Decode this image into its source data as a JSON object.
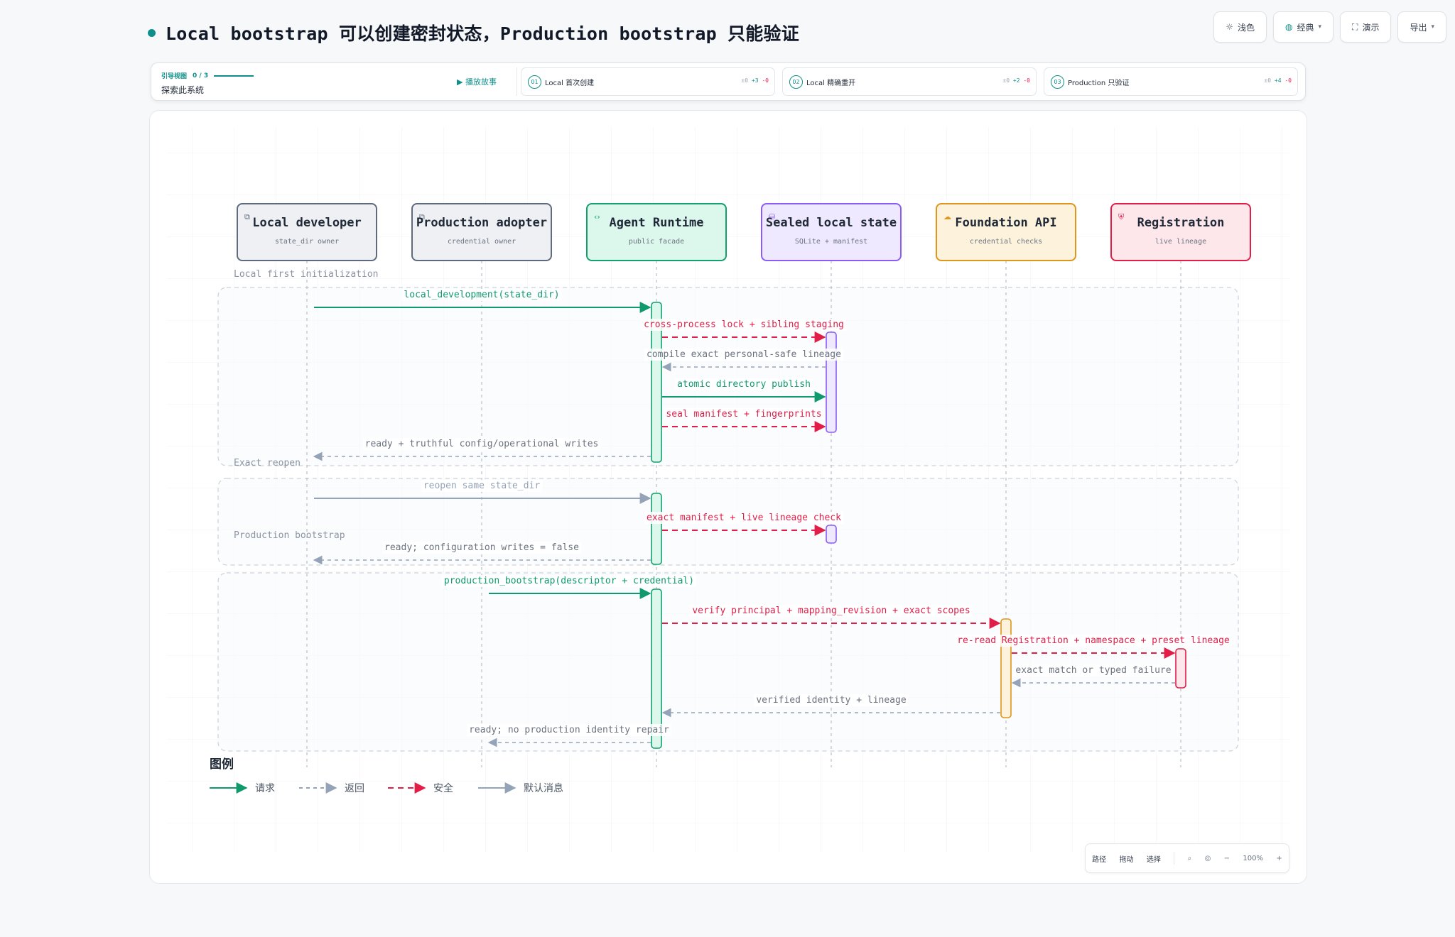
{
  "title": "Local bootstrap 可以创建密封状态，Production bootstrap 只能验证",
  "toolbar": [
    {
      "icon": "sun-icon",
      "label": "浅色",
      "dropdown": false
    },
    {
      "icon": "palette-icon",
      "label": "经典",
      "dropdown": true
    },
    {
      "icon": "fullscreen-icon",
      "label": "演示",
      "dropdown": false
    },
    {
      "icon": "",
      "label": "导出",
      "dropdown": true
    }
  ],
  "guide": {
    "kicker": "引导视图",
    "progress": "0 / 3",
    "subtitle": "探索此系统",
    "play_label": "播放故事",
    "steps": [
      {
        "num": "01",
        "label": "Local 首次创建",
        "zero": "±0",
        "plus": "+3",
        "minus": "-0"
      },
      {
        "num": "02",
        "label": "Local 精确重开",
        "zero": "±0",
        "plus": "+2",
        "minus": "-0"
      },
      {
        "num": "03",
        "label": "Production 只验证",
        "zero": "±0",
        "plus": "+4",
        "minus": "-0"
      }
    ]
  },
  "colors": {
    "request": "#0e9a6c",
    "return": "#94a3b8",
    "security": "#e11d48",
    "default": "#94a3b8"
  },
  "participants": [
    {
      "id": "local",
      "name": "Local developer",
      "sub": "state_dir owner",
      "icon": "external-link-icon",
      "fill": "#eef0f4",
      "stroke": "#5f6b7d",
      "bar": "#5f6b7d"
    },
    {
      "id": "prod",
      "name": "Production adopter",
      "sub": "credential owner",
      "icon": "external-link-icon",
      "fill": "#eef0f4",
      "stroke": "#5f6b7d",
      "bar": "#5f6b7d"
    },
    {
      "id": "runtime",
      "name": "Agent Runtime",
      "sub": "public facade",
      "icon": "code-icon",
      "fill": "#dcf7ec",
      "stroke": "#15a06f",
      "bar": "#15a06f"
    },
    {
      "id": "sealed",
      "name": "Sealed local state",
      "sub": "SQLite + manifest",
      "icon": "database-icon",
      "fill": "#efe9ff",
      "stroke": "#8b5cf6",
      "bar": "#8b5cf6"
    },
    {
      "id": "foundation",
      "name": "Foundation API",
      "sub": "credential checks",
      "icon": "cloud-icon",
      "fill": "#fdf3dc",
      "stroke": "#e0951c",
      "bar": "#e0951c"
    },
    {
      "id": "registration",
      "name": "Registration",
      "sub": "live lineage",
      "icon": "shield-icon",
      "fill": "#fde7ea",
      "stroke": "#e11d48",
      "bar": "#e11d48"
    }
  ],
  "groups": [
    {
      "label": "Local first initialization"
    },
    {
      "label": "Exact reopen"
    },
    {
      "label": "Production bootstrap"
    }
  ],
  "messages": [
    {
      "from": "local",
      "to": "runtime",
      "label": "local_development(state_dir)",
      "kind": "request"
    },
    {
      "from": "runtime",
      "to": "sealed",
      "label": "cross-process lock + sibling staging",
      "kind": "security"
    },
    {
      "from": "sealed",
      "to": "runtime",
      "label": "compile exact personal-safe lineage",
      "kind": "return"
    },
    {
      "from": "runtime",
      "to": "sealed",
      "label": "atomic directory publish",
      "kind": "request"
    },
    {
      "from": "runtime",
      "to": "sealed",
      "label": "seal manifest + fingerprints",
      "kind": "security"
    },
    {
      "from": "runtime",
      "to": "local",
      "label": "ready + truthful config/operational writes",
      "kind": "return"
    },
    {
      "from": "local",
      "to": "runtime",
      "label": "reopen same state_dir",
      "kind": "default"
    },
    {
      "from": "runtime",
      "to": "sealed",
      "label": "exact manifest + live lineage check",
      "kind": "security"
    },
    {
      "from": "runtime",
      "to": "local",
      "label": "ready; configuration writes = false",
      "kind": "return"
    },
    {
      "from": "prod",
      "to": "runtime",
      "label": "production_bootstrap(descriptor + credential)",
      "kind": "request"
    },
    {
      "from": "runtime",
      "to": "foundation",
      "label": "verify principal + mapping_revision + exact scopes",
      "kind": "security"
    },
    {
      "from": "foundation",
      "to": "registration",
      "label": "re-read Registration + namespace + preset lineage",
      "kind": "security"
    },
    {
      "from": "registration",
      "to": "foundation",
      "label": "exact match or typed failure",
      "kind": "return"
    },
    {
      "from": "foundation",
      "to": "runtime",
      "label": "verified identity + lineage",
      "kind": "return"
    },
    {
      "from": "runtime",
      "to": "prod",
      "label": "ready; no production identity repair",
      "kind": "return"
    }
  ],
  "legend": {
    "title": "图例",
    "items": [
      {
        "label": "请求",
        "kind": "request"
      },
      {
        "label": "返回",
        "kind": "return"
      },
      {
        "label": "安全",
        "kind": "security"
      },
      {
        "label": "默认消息",
        "kind": "default"
      }
    ]
  },
  "zoom_bar": {
    "items": [
      "路径",
      "拖动",
      "选择"
    ],
    "zoom_level": "100%",
    "minus": "−",
    "plus": "+"
  }
}
